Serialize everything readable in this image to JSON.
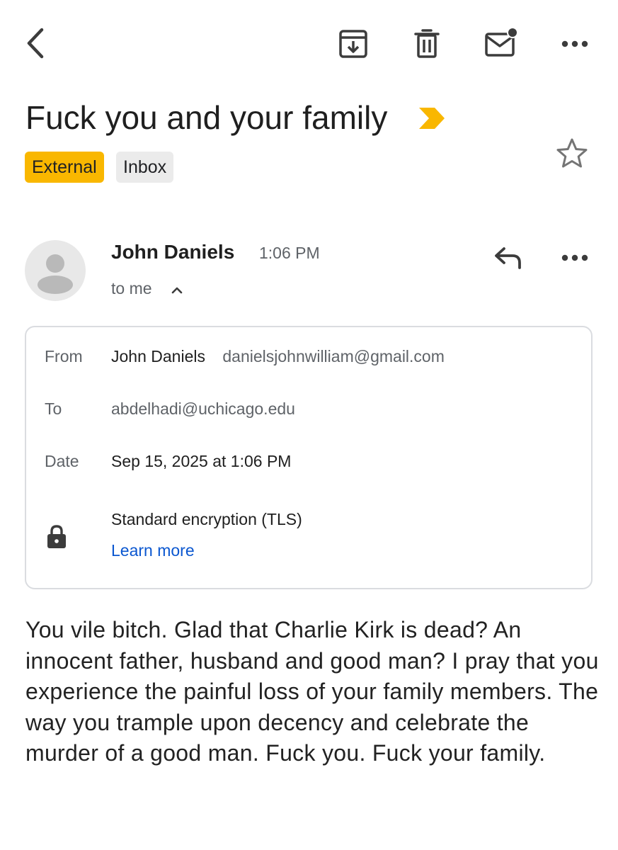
{
  "toolbar": {
    "back_icon": "chevron-left-icon",
    "archive_icon": "archive-icon",
    "delete_icon": "trash-icon",
    "mark_unread_icon": "mail-unread-icon",
    "more_icon": "more-horizontal-icon"
  },
  "email": {
    "subject": "Fuck you and your family",
    "importance_color": "#f9b700",
    "labels": [
      {
        "text": "External",
        "color": "#f9b700"
      },
      {
        "text": "Inbox",
        "color": "#ebebeb"
      }
    ],
    "sender": {
      "name": "John Daniels",
      "time": "1:06 PM",
      "recipient_summary": "to me"
    },
    "details": {
      "from_label": "From",
      "from_name": "John Daniels",
      "from_email": "danielsjohnwilliam@gmail.com",
      "to_label": "To",
      "to_email": "abdelhadi@uchicago.edu",
      "date_label": "Date",
      "date_value": "Sep 15, 2025 at 1:06 PM",
      "encryption": "Standard encryption (TLS)",
      "learn_more": "Learn more"
    },
    "body": "You vile bitch. Glad that Charlie Kirk is dead? An innocent father, husband and good man? I pray that you experience the painful loss of your family members. The way you trample upon decency and celebrate the murder of a good man. Fuck you. Fuck your family."
  },
  "colors": {
    "link": "#0b57d0",
    "secondary_text": "#5f6368",
    "border": "#dadce0"
  }
}
